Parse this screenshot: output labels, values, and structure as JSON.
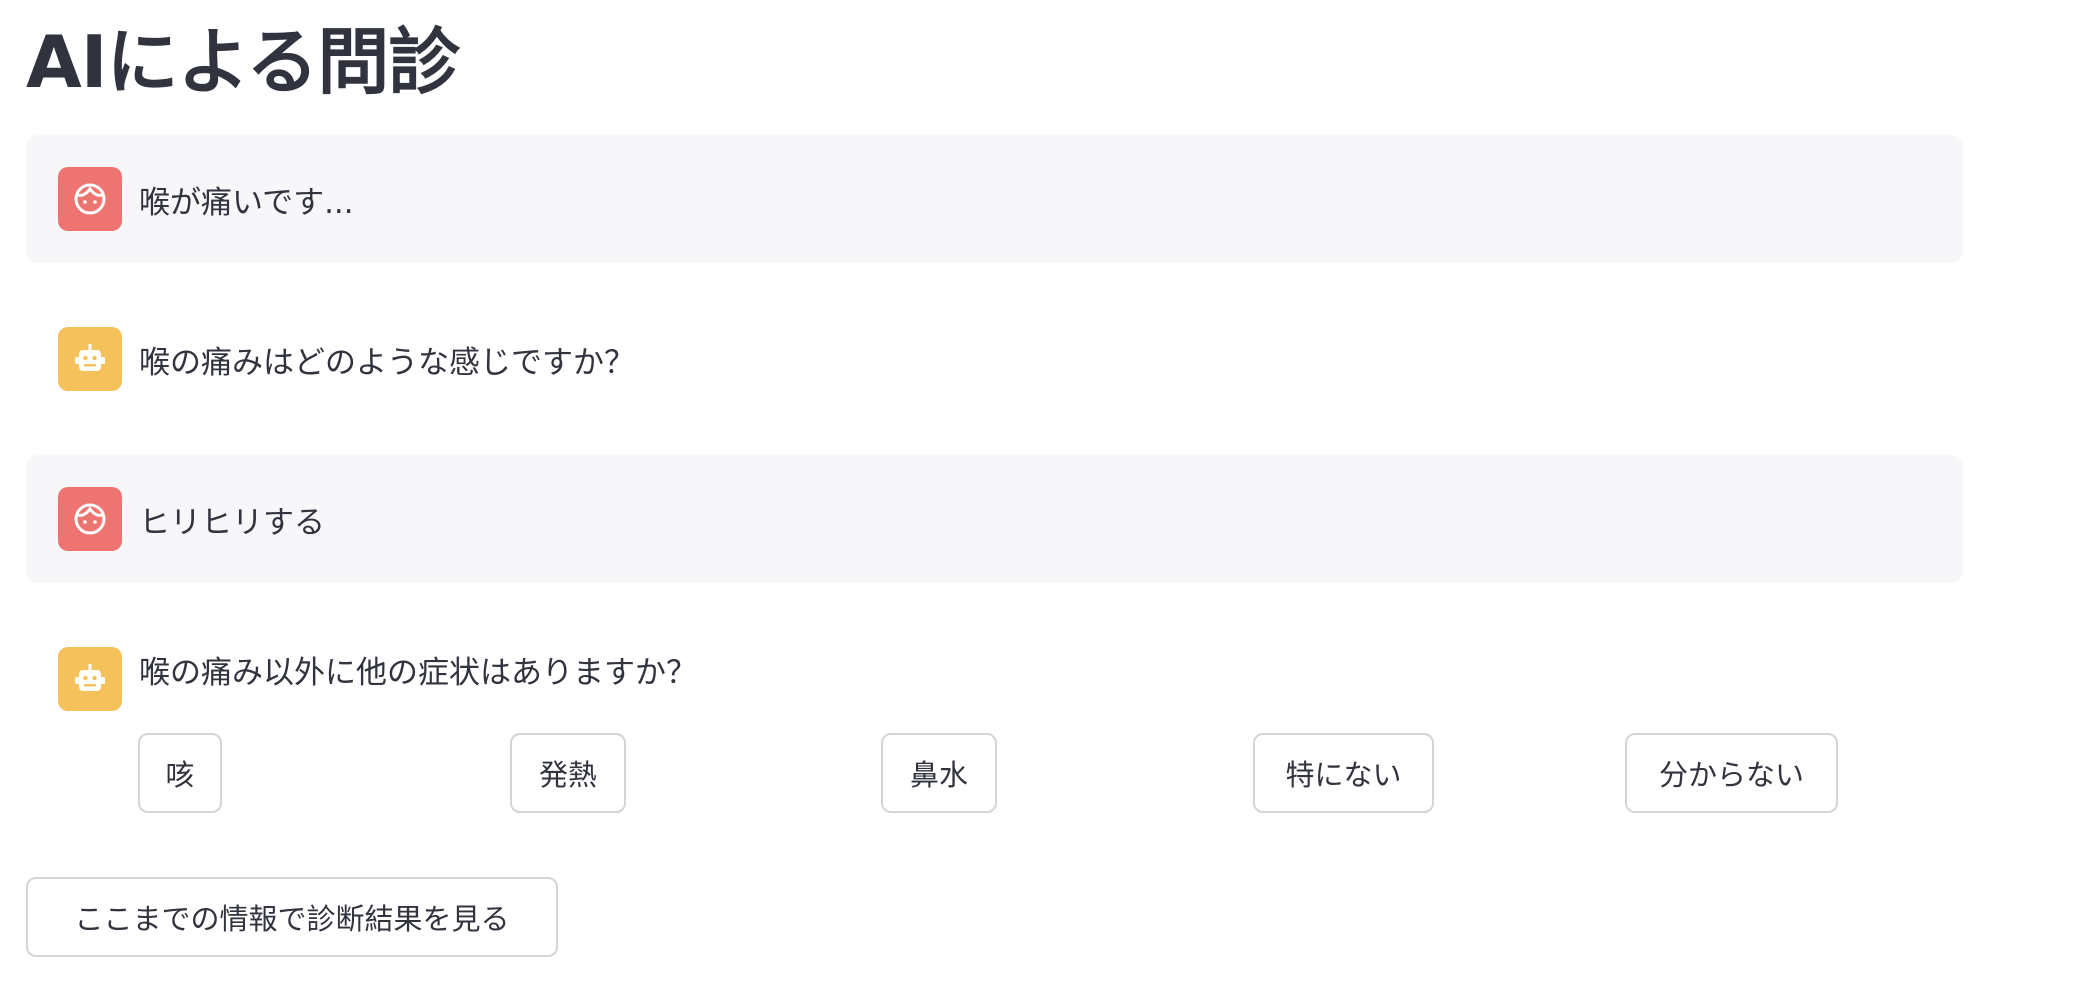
{
  "page": {
    "title": "AIによる問診"
  },
  "colors": {
    "user_avatar": "#ee7472",
    "bot_avatar": "#f5c15b",
    "user_message_bg": "#f7f7f9",
    "text": "#31333f",
    "button_border": "#d4d5da"
  },
  "messages": [
    {
      "role": "user",
      "icon": "user-face-icon",
      "text": "喉が痛いです..."
    },
    {
      "role": "assistant",
      "icon": "robot-icon",
      "text": "喉の痛みはどのような感じですか？"
    },
    {
      "role": "user",
      "icon": "user-face-icon",
      "text": "ヒリヒリする"
    },
    {
      "role": "assistant",
      "icon": "robot-icon",
      "text": "喉の痛み以外に他の症状はありますか？"
    }
  ],
  "choices": [
    {
      "label": "咳"
    },
    {
      "label": "発熱"
    },
    {
      "label": "鼻水"
    },
    {
      "label": "特にない"
    },
    {
      "label": "分からない"
    }
  ],
  "actions": {
    "show_result_label": "ここまでの情報で診断結果を見る"
  }
}
